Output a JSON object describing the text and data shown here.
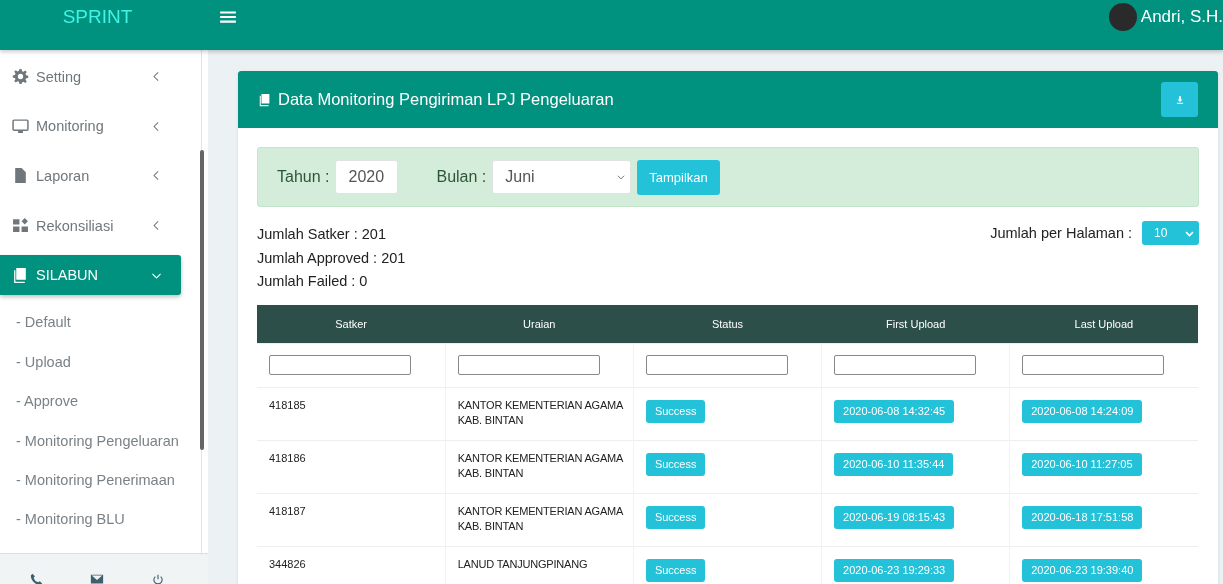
{
  "app": {
    "brand": "SPRINT",
    "user": "Andri, S.H."
  },
  "sidebar": {
    "items": [
      {
        "label": "Setting",
        "expanded": false,
        "selected": false
      },
      {
        "label": "Monitoring",
        "expanded": false,
        "selected": false
      },
      {
        "label": "Laporan",
        "expanded": false,
        "selected": false
      },
      {
        "label": "Rekonsiliasi",
        "expanded": false,
        "selected": false
      },
      {
        "label": "SILABUN",
        "expanded": true,
        "selected": true,
        "children": [
          {
            "label": "- Default"
          },
          {
            "label": "- Upload"
          },
          {
            "label": "- Approve"
          },
          {
            "label": "- Monitoring Pengeluaran"
          },
          {
            "label": "- Monitoring Penerimaan"
          },
          {
            "label": "- Monitoring BLU"
          }
        ]
      }
    ]
  },
  "panel": {
    "title": "Data Monitoring Pengiriman LPJ Pengeluaran",
    "filter": {
      "year_label": "Tahun :",
      "year": "2020",
      "month_label": "Bulan :",
      "month": "Juni",
      "button": "Tampilkan"
    },
    "summary": [
      "Jumlah Satker : 201",
      "Jumlah Approved : 201",
      "Jumlah Failed : 0"
    ],
    "page_size_label": "Jumlah per Halaman :",
    "page_size": "10",
    "table": {
      "columns": [
        "Satker",
        "Uraian",
        "Status",
        "First Upload",
        "Last Upload"
      ],
      "rows": [
        {
          "satker": "418185",
          "uraian": "KANTOR KEMENTERIAN AGAMA KAB. BINTAN",
          "status": "Success",
          "first_upload": "2020-06-08 14:32:45",
          "last_upload": "2020-06-08 14:24:09"
        },
        {
          "satker": "418186",
          "uraian": "KANTOR KEMENTERIAN AGAMA KAB. BINTAN",
          "status": "Success",
          "first_upload": "2020-06-10 11:35:44",
          "last_upload": "2020-06-10 11:27:05"
        },
        {
          "satker": "418187",
          "uraian": "KANTOR KEMENTERIAN AGAMA KAB. BINTAN",
          "status": "Success",
          "first_upload": "2020-06-19 08:15:43",
          "last_upload": "2020-06-18 17:51:58"
        },
        {
          "satker": "344826",
          "uraian": "LANUD TANJUNGPINANG",
          "status": "Success",
          "first_upload": "2020-06-23 19:29:33",
          "last_upload": "2020-06-23 19:39:40"
        }
      ]
    }
  }
}
